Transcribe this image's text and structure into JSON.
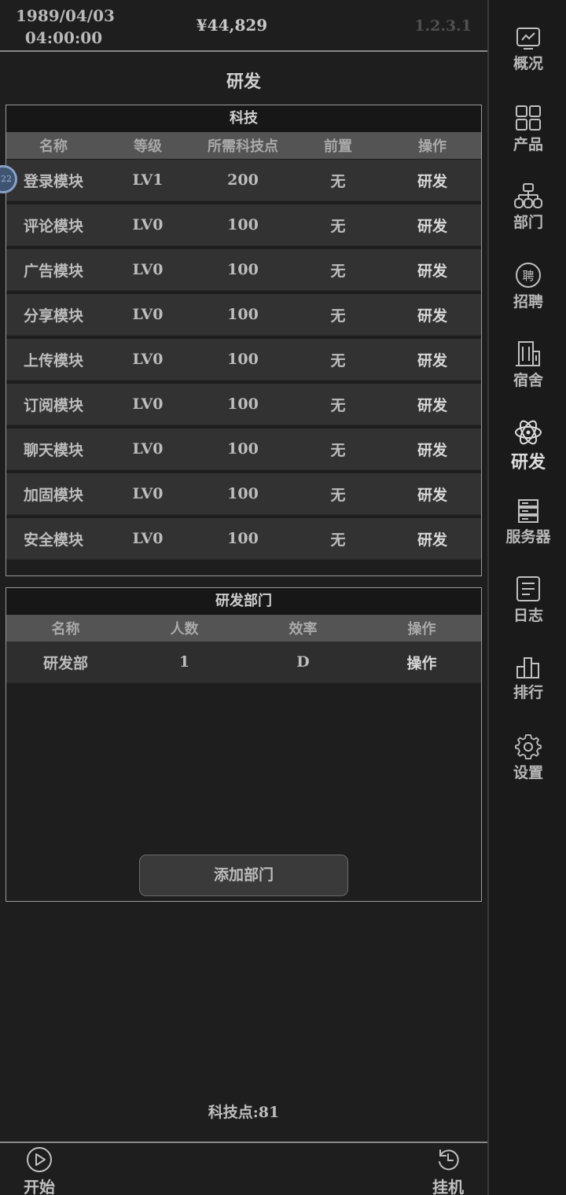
{
  "header": {
    "date": "1989/04/03",
    "time": "04:00:00",
    "money": "¥44,829",
    "version": "1.2.3.1"
  },
  "page_title": "研发",
  "tech_panel": {
    "title": "科技",
    "columns": [
      "名称",
      "等级",
      "所需科技点",
      "前置",
      "操作"
    ],
    "rows": [
      {
        "name": "登录模块",
        "level": "LV1",
        "cost": "200",
        "prereq": "无",
        "action": "研发"
      },
      {
        "name": "评论模块",
        "level": "LV0",
        "cost": "100",
        "prereq": "无",
        "action": "研发"
      },
      {
        "name": "广告模块",
        "level": "LV0",
        "cost": "100",
        "prereq": "无",
        "action": "研发"
      },
      {
        "name": "分享模块",
        "level": "LV0",
        "cost": "100",
        "prereq": "无",
        "action": "研发"
      },
      {
        "name": "上传模块",
        "level": "LV0",
        "cost": "100",
        "prereq": "无",
        "action": "研发"
      },
      {
        "name": "订阅模块",
        "level": "LV0",
        "cost": "100",
        "prereq": "无",
        "action": "研发"
      },
      {
        "name": "聊天模块",
        "level": "LV0",
        "cost": "100",
        "prereq": "无",
        "action": "研发"
      },
      {
        "name": "加固模块",
        "level": "LV0",
        "cost": "100",
        "prereq": "无",
        "action": "研发"
      },
      {
        "name": "安全模块",
        "level": "LV0",
        "cost": "100",
        "prereq": "无",
        "action": "研发"
      }
    ]
  },
  "dept_panel": {
    "title": "研发部门",
    "columns": [
      "名称",
      "人数",
      "效率",
      "操作"
    ],
    "rows": [
      {
        "name": "研发部",
        "count": "1",
        "efficiency": "D",
        "action": "操作"
      }
    ],
    "add_button": "添加部门"
  },
  "tech_points": "科技点:81",
  "float_badge": "22",
  "bottom": {
    "start_label": "开始",
    "idle_label": "挂机"
  },
  "sidebar": {
    "items": [
      {
        "label": "概况",
        "icon": "chart-icon"
      },
      {
        "label": "产品",
        "icon": "grid-icon"
      },
      {
        "label": "部门",
        "icon": "org-icon"
      },
      {
        "label": "招聘",
        "icon": "hire-icon",
        "glyph": "聘"
      },
      {
        "label": "宿舍",
        "icon": "building-icon"
      },
      {
        "label": "研发",
        "icon": "atom-icon"
      },
      {
        "label": "服务器",
        "icon": "server-icon"
      },
      {
        "label": "日志",
        "icon": "log-icon"
      },
      {
        "label": "排行",
        "icon": "rank-icon"
      },
      {
        "label": "设置",
        "icon": "gear-icon"
      }
    ]
  }
}
